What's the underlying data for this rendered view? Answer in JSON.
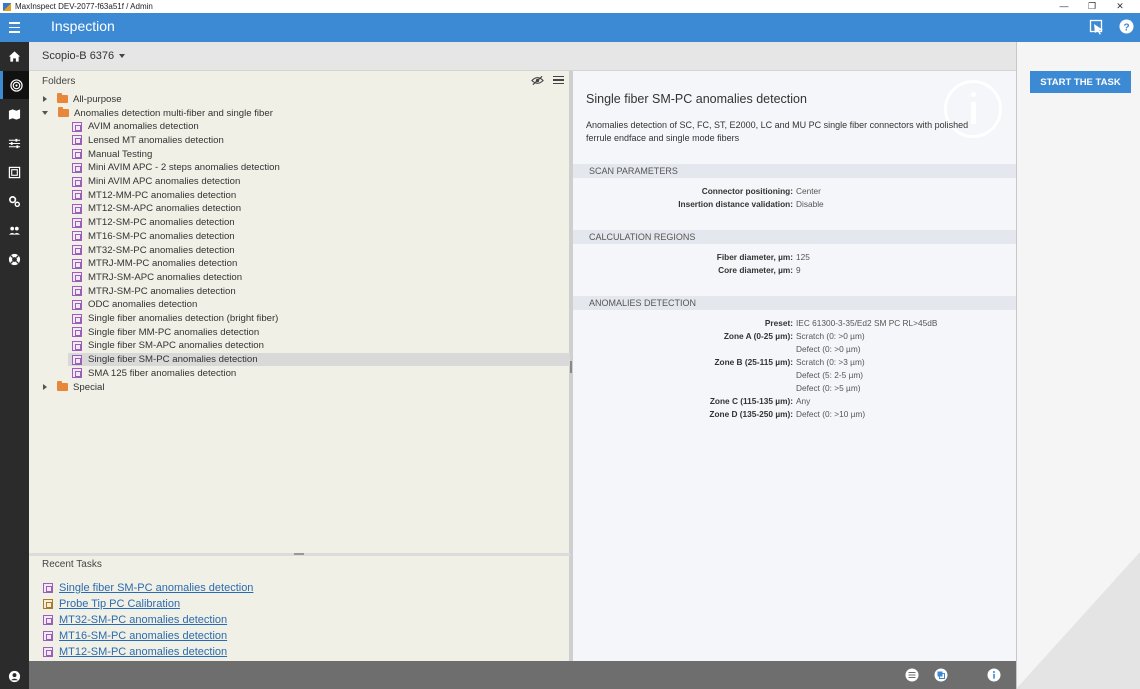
{
  "window": {
    "title": "MaxInspect DEV-2077-f63a51f / Admin",
    "controls": [
      "—",
      "❐",
      "✕"
    ]
  },
  "header": {
    "title": "Inspection",
    "icons": [
      "menu-icon",
      "screenshot-icon",
      "help-icon"
    ]
  },
  "leftnav": {
    "items": [
      "home-icon",
      "target-icon",
      "map-icon",
      "sliders-icon",
      "gallery-icon",
      "settings-icon",
      "users-icon",
      "support-icon",
      "user-icon"
    ],
    "active": "target-icon"
  },
  "device": {
    "name": "Scopio-B 6376"
  },
  "folders": {
    "heading": "Folders",
    "tree": [
      {
        "label": "All-purpose",
        "type": "folder",
        "expanded": false,
        "level": 0
      },
      {
        "label": "Anomalies detection multi-fiber and single fiber",
        "type": "folder",
        "expanded": true,
        "level": 0
      },
      {
        "label": "AVIM anomalies detection",
        "type": "task",
        "level": 1
      },
      {
        "label": "Lensed MT anomalies detection",
        "type": "task",
        "level": 1
      },
      {
        "label": "Manual Testing",
        "type": "task",
        "level": 1
      },
      {
        "label": "Mini AVIM APC - 2 steps anomalies detection",
        "type": "task",
        "level": 1
      },
      {
        "label": "Mini AVIM APC anomalies detection",
        "type": "task",
        "level": 1
      },
      {
        "label": "MT12-MM-PC anomalies detection",
        "type": "task",
        "level": 1
      },
      {
        "label": "MT12-SM-APC anomalies detection",
        "type": "task",
        "level": 1
      },
      {
        "label": "MT12-SM-PC anomalies detection",
        "type": "task",
        "level": 1
      },
      {
        "label": "MT16-SM-PC anomalies detection",
        "type": "task",
        "level": 1
      },
      {
        "label": "MT32-SM-PC anomalies detection",
        "type": "task",
        "level": 1
      },
      {
        "label": "MTRJ-MM-PC anomalies detection",
        "type": "task",
        "level": 1
      },
      {
        "label": "MTRJ-SM-APC anomalies detection",
        "type": "task",
        "level": 1
      },
      {
        "label": "MTRJ-SM-PC anomalies detection",
        "type": "task",
        "level": 1
      },
      {
        "label": "ODC anomalies detection",
        "type": "task",
        "level": 1
      },
      {
        "label": "Single fiber anomalies detection (bright fiber)",
        "type": "task",
        "level": 1
      },
      {
        "label": "Single fiber MM-PC anomalies detection",
        "type": "task",
        "level": 1
      },
      {
        "label": "Single fiber SM-APC anomalies detection",
        "type": "task",
        "level": 1
      },
      {
        "label": "Single fiber SM-PC anomalies detection",
        "type": "task",
        "level": 1,
        "selected": true
      },
      {
        "label": "SMA 125 fiber anomalies detection",
        "type": "task",
        "level": 1
      },
      {
        "label": "Special",
        "type": "folder",
        "expanded": false,
        "level": 0
      }
    ]
  },
  "recent": {
    "heading": "Recent Tasks",
    "items": [
      {
        "label": "Single fiber SM-PC anomalies detection",
        "kind": "task"
      },
      {
        "label": "Probe Tip PC Calibration",
        "kind": "calibration"
      },
      {
        "label": "MT32-SM-PC anomalies detection",
        "kind": "task"
      },
      {
        "label": "MT16-SM-PC anomalies detection",
        "kind": "task"
      },
      {
        "label": "MT12-SM-PC anomalies detection",
        "kind": "task"
      }
    ]
  },
  "details": {
    "title": "Single fiber SM-PC anomalies detection",
    "description": "Anomalies detection of SC, FC, ST, E2000, LC and MU PC single fiber connectors with polished ferrule endface and single mode fibers",
    "sections": [
      {
        "title": "SCAN PARAMETERS",
        "rows": [
          {
            "key": "Connector positioning:",
            "value": "Center"
          },
          {
            "key": "Insertion distance validation:",
            "value": "Disable"
          }
        ]
      },
      {
        "title": "CALCULATION REGIONS",
        "rows": [
          {
            "key": "Fiber diameter, µm:",
            "value": "125"
          },
          {
            "key": "Core diameter, µm:",
            "value": "9"
          }
        ]
      },
      {
        "title": "ANOMALIES DETECTION",
        "rows": [
          {
            "key": "Preset:",
            "value": "IEC 61300-3-35/Ed2 SM PC RL>45dB"
          },
          {
            "key": "Zone A (0-25 µm):",
            "value": "Scratch (0: >0 µm)"
          },
          {
            "key": "",
            "value": "Defect (0: >0 µm)"
          },
          {
            "key": "Zone B (25-115 µm):",
            "value": "Scratch (0: >3 µm)"
          },
          {
            "key": "",
            "value": "Defect (5: 2-5 µm)"
          },
          {
            "key": "",
            "value": "Defect (0: >5 µm)"
          },
          {
            "key": "Zone C (115-135 µm):",
            "value": "Any"
          },
          {
            "key": "Zone D (135-250 µm):",
            "value": "Defect (0: >10 µm)"
          }
        ]
      }
    ]
  },
  "actions": {
    "start_task": "START THE TASK"
  },
  "bottombar": {
    "icons": [
      "list-icon",
      "copy-icon",
      "info-icon"
    ]
  },
  "colors": {
    "accent": "#3d8ad4",
    "nav_bg": "#2b2b2b",
    "tree_bg": "#f1f0e6",
    "link": "#2a6bb0"
  }
}
